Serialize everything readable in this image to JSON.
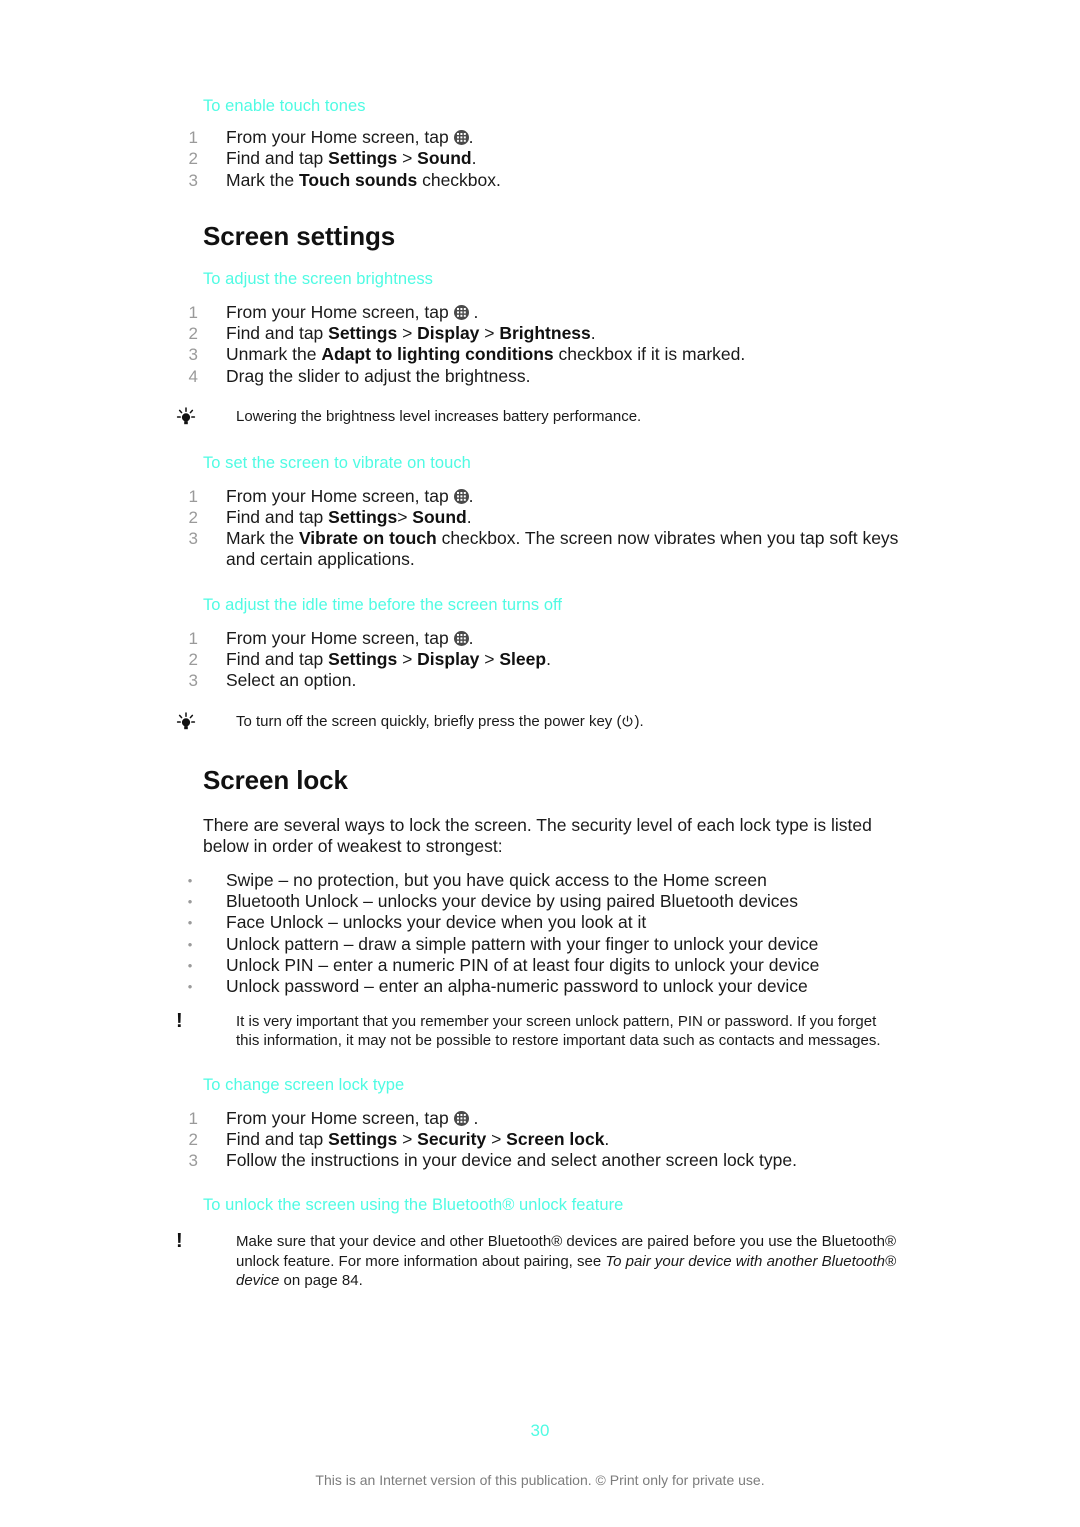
{
  "document": {
    "page_number": "30",
    "footer": "This is an Internet version of this publication. © Print only for private use.",
    "accent_color": "#4FFBE3",
    "text_color": "#1a1a1a",
    "muted_color": "#9a9a9a"
  },
  "sections": {
    "touch_tones": {
      "heading": "To enable touch tones",
      "steps": [
        {
          "num": "1",
          "pre": "From your Home screen, tap ",
          "icon": "app-drawer-icon",
          "post": "."
        },
        {
          "num": "2",
          "pre": "Find and tap ",
          "b1": "Settings",
          "mid": " > ",
          "b2": "Sound",
          "post": "."
        },
        {
          "num": "3",
          "pre": "Mark the ",
          "b1": "Touch sounds",
          "post": " checkbox."
        }
      ]
    },
    "screen_settings": {
      "title": "Screen settings",
      "brightness": {
        "heading": "To adjust the screen brightness",
        "steps": [
          {
            "num": "1",
            "pre": "From your Home screen, tap ",
            "icon": "app-drawer-icon",
            "post": " ."
          },
          {
            "num": "2",
            "pre": "Find and tap ",
            "b1": "Settings",
            "mid": " > ",
            "b2": "Display",
            "mid2": " > ",
            "b3": "Brightness",
            "post": "."
          },
          {
            "num": "3",
            "pre": "Unmark the ",
            "b1": "Adapt to lighting conditions",
            "post": " checkbox if it is marked."
          },
          {
            "num": "4",
            "pre": "Drag the slider to adjust the brightness."
          }
        ],
        "tip": "Lowering the brightness level increases battery performance."
      },
      "vibrate": {
        "heading": "To set the screen to vibrate on touch",
        "steps": [
          {
            "num": "1",
            "pre": "From your Home screen, tap ",
            "icon": "app-drawer-icon",
            "post": "."
          },
          {
            "num": "2",
            "pre": "Find and tap ",
            "b1": "Settings",
            "mid": "> ",
            "b2": "Sound",
            "post": "."
          },
          {
            "num": "3",
            "pre": "Mark the ",
            "b1": "Vibrate on touch",
            "post": " checkbox. The screen now vibrates when you tap soft keys and certain applications."
          }
        ]
      },
      "idle_time": {
        "heading": "To adjust the idle time before the screen turns off",
        "steps": [
          {
            "num": "1",
            "pre": "From your Home screen, tap ",
            "icon": "app-drawer-icon",
            "post": "."
          },
          {
            "num": "2",
            "pre": "Find and tap ",
            "b1": "Settings",
            "mid": " > ",
            "b2": "Display",
            "mid2": " > ",
            "b3": "Sleep",
            "post": "."
          },
          {
            "num": "3",
            "pre": "Select an option."
          }
        ],
        "tip_pre": "To turn off the screen quickly, briefly press the power key (",
        "tip_icon": "power-key-icon",
        "tip_post": ")."
      }
    },
    "screen_lock": {
      "title": "Screen lock",
      "intro": "There are several ways to lock the screen. The security level of each lock type is listed below in order of weakest to strongest:",
      "lock_types": [
        "Swipe – no protection, but you have quick access to the Home screen",
        "Bluetooth Unlock – unlocks your device by using paired Bluetooth devices",
        "Face Unlock – unlocks your device when you look at it",
        "Unlock pattern – draw a simple pattern with your finger to unlock your device",
        "Unlock PIN – enter a numeric PIN of at least four digits to unlock your device",
        "Unlock password – enter an alpha-numeric password to unlock your device"
      ],
      "warning": "It is very important that you remember your screen unlock pattern, PIN or password. If you forget this information, it may not be possible to restore important data such as contacts and messages.",
      "change_type": {
        "heading": "To change screen lock type",
        "steps": [
          {
            "num": "1",
            "pre": "From your Home screen, tap ",
            "icon": "app-drawer-icon",
            "post": " ."
          },
          {
            "num": "2",
            "pre": "Find and tap ",
            "b1": "Settings",
            "mid": " > ",
            "b2": "Security",
            "mid2": " > ",
            "b3": "Screen lock",
            "post": "."
          },
          {
            "num": "3",
            "pre": "Follow the instructions in your device and select another screen lock type."
          }
        ]
      },
      "bluetooth_unlock": {
        "heading": "To unlock the screen using the Bluetooth® unlock feature",
        "warning_pre": "Make sure that your device and other Bluetooth® devices are paired before you use the Bluetooth® unlock feature. For more information about pairing, see ",
        "warning_italic": "To pair your device with another Bluetooth® device",
        "warning_post": " on page 84."
      }
    }
  }
}
